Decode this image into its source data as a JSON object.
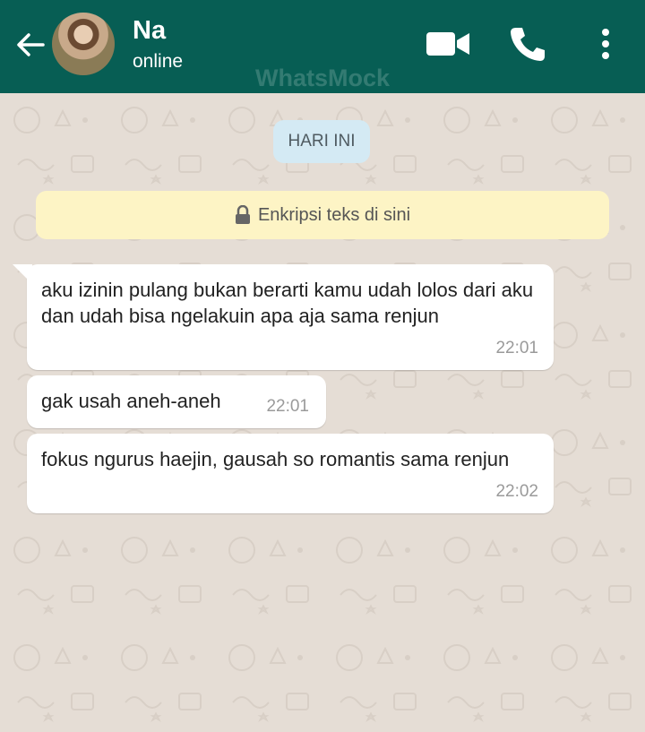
{
  "header": {
    "contact_name": "Na",
    "status": "online",
    "watermark": "WhatsMock",
    "color": "#075e54"
  },
  "chat": {
    "date_label": "HARI INI",
    "encryption_notice": "Enkripsi teks di sini",
    "messages": [
      {
        "text": "aku izinin pulang bukan berarti kamu udah lolos dari aku dan udah bisa ngelakuin apa aja sama renjun",
        "time": "22:01"
      },
      {
        "text": "gak usah aneh-aneh",
        "time": "22:01"
      },
      {
        "text": "fokus ngurus haejin, gausah so romantis sama renjun",
        "time": "22:02"
      }
    ]
  },
  "icons": [
    "back-arrow-icon",
    "video-call-icon",
    "phone-icon",
    "more-vert-icon",
    "lock-icon"
  ]
}
